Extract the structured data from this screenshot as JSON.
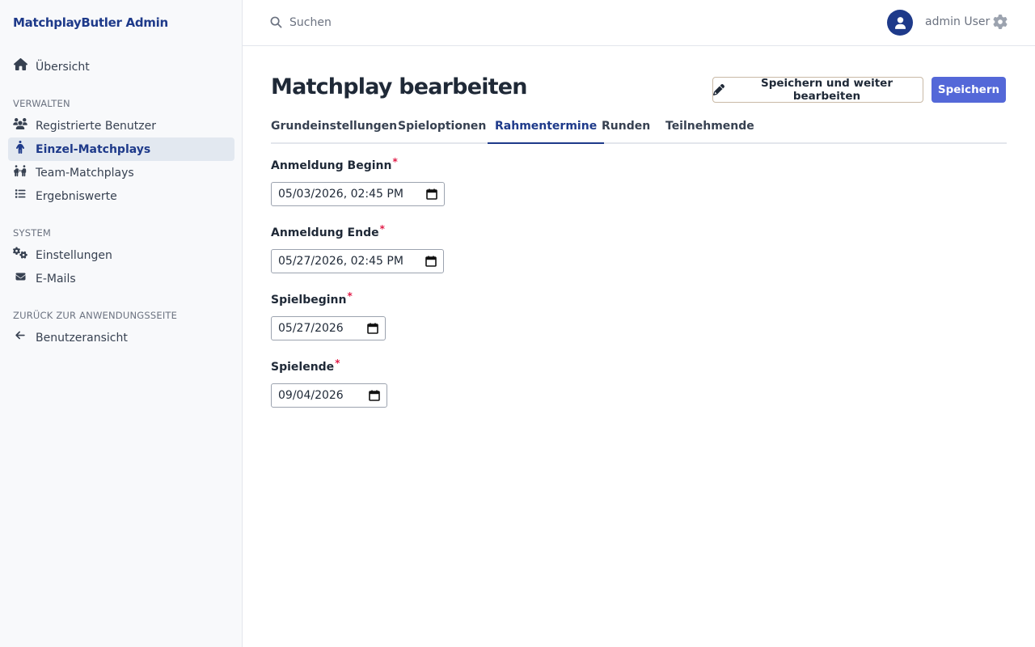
{
  "sidebar": {
    "brand": "MatchplayButler Admin",
    "overview": "Übersicht",
    "section_manage": "Verwalten",
    "items_manage": [
      {
        "label": "Registrierte Benutzer",
        "icon": "users-icon"
      },
      {
        "label": "Einzel-Matchplays",
        "icon": "person-icon",
        "active": true
      },
      {
        "label": "Team-Matchplays",
        "icon": "team-icon"
      },
      {
        "label": "Ergebniswerte",
        "icon": "list-icon"
      }
    ],
    "section_system": "System",
    "items_system": [
      {
        "label": "Einstellungen",
        "icon": "cogs-icon"
      },
      {
        "label": "E-Mails",
        "icon": "envelope-icon"
      }
    ],
    "section_back": "Zurück zur Anwendungsseite",
    "back_item": {
      "label": "Benutzeransicht",
      "icon": "arrow-left-icon"
    }
  },
  "topbar": {
    "search_placeholder": "Suchen",
    "user_name": "admin User"
  },
  "page": {
    "title": "Matchplay bearbeiten",
    "save_continue_label": "Speichern und weiter bearbeiten",
    "save_label": "Speichern"
  },
  "tabs": [
    {
      "label": "Grundeinstellungen"
    },
    {
      "label": "Spieloptionen"
    },
    {
      "label": "Rahmentermine",
      "active": true
    },
    {
      "label": "Runden"
    },
    {
      "label": "Teilnehmende"
    }
  ],
  "form": {
    "fields": [
      {
        "label": "Anmeldung Beginn",
        "value": "05/03/2026, 02:45 PM",
        "required": "*"
      },
      {
        "label": "Anmeldung Ende",
        "value": "05/27/2026, 02:45 PM",
        "required": "*"
      },
      {
        "label": "Spielbeginn",
        "value": "05/27/2026",
        "required": "*"
      },
      {
        "label": "Spielende",
        "value": "09/04/2026",
        "required": "*"
      }
    ]
  },
  "colors": {
    "accent": "#1e3a8a",
    "primary_button": "#5468d8",
    "required": "#e11d48"
  }
}
